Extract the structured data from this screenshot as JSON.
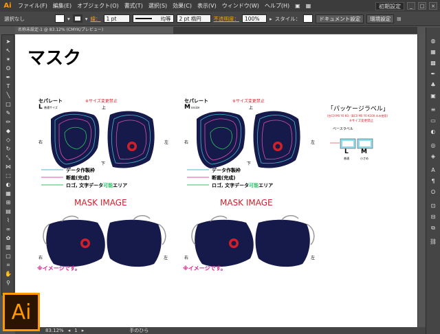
{
  "menu": {
    "logo": "Ai",
    "items": [
      "ファイル(F)",
      "編集(E)",
      "オブジェクト(O)",
      "書式(T)",
      "選択(S)",
      "効果(C)",
      "表示(V)",
      "ウィンドウ(W)",
      "ヘルプ(H)"
    ],
    "workspace": "初期設定"
  },
  "control": {
    "selection": "選択なし",
    "stroke_label": "線：",
    "stroke_width": "1 pt",
    "stroke_profile": "均等",
    "brush": "2 pt 楕円",
    "opacity_label": "不透明度：",
    "opacity_value": "100%",
    "style_label": "スタイル：",
    "doc_settings": "ドキュメント設定",
    "prefs": "環境設定"
  },
  "document": {
    "tab_title": "名称未設定-1 @ 83.12% (CMYK/プレビュー)"
  },
  "status": {
    "zoom": "83.12%",
    "page": "1",
    "tool": "手のひら"
  },
  "artwork": {
    "title": "マスク",
    "left": {
      "label": "セパレート",
      "size": "L",
      "size_note": "普通サイズ",
      "warning": "※サイズ変更禁止",
      "top": "上",
      "right": "右",
      "left_side": "左",
      "bottom": "下",
      "mask_image": "MASK IMAGE",
      "image_note": "※イメージです。",
      "img_right": "右",
      "img_left": "左"
    },
    "right": {
      "label": "セパレート",
      "size": "M",
      "size_note": "ossize",
      "warning": "※サイズ変更禁止",
      "top": "上",
      "right": "右",
      "left_side": "左",
      "bottom": "下",
      "mask_image": "MASK IMAGE",
      "image_note": "※イメージです。",
      "img_right": "右",
      "img_left": "左"
    },
    "legend": [
      {
        "label": "データ作製枠",
        "color": "#4ab8d8"
      },
      {
        "label": "断裁(完成)",
        "color": "#e050b0"
      },
      {
        "label": "ロゴ, 文字データ",
        "highlight": "可能",
        "suffix": "エリア",
        "color": "#30c060"
      }
    ],
    "package": {
      "title": "「パッケージラベル」",
      "note1": "(台C0 M0 Y0 K0／高C0 M0 Y0 K100 のみ使用)",
      "note2": "※サイズ変更禁止",
      "base_label": "ベースラベル",
      "size_l": "L",
      "size_m": "M",
      "size_l_note": "普通",
      "size_m_note": "小さめ"
    }
  },
  "colors": {
    "navy": "#161a4a",
    "red_text": "#d0202a",
    "magenta": "#e0208a",
    "logo_red": "#d0202a"
  }
}
